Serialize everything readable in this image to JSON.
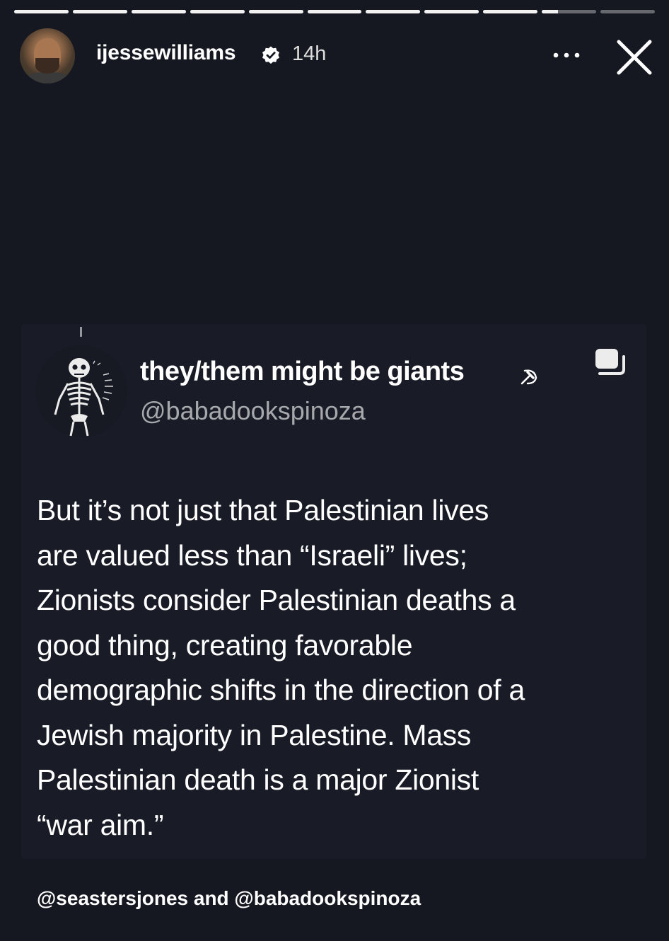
{
  "story": {
    "progress_segments": [
      1,
      1,
      1,
      1,
      1,
      1,
      1,
      1,
      1,
      0.3,
      0
    ],
    "username": "ijessewilliams",
    "verified": true,
    "time_ago": "14h",
    "more_icon": "more-horizontal-icon",
    "close_icon": "close-icon"
  },
  "tweet": {
    "display_name": "they/them might be giants",
    "name_emoji": "hammer-sickle-icon",
    "handle": "@babadookspinoza",
    "avatar_icon": "skeleton-icon",
    "copy_icon": "copy-icon",
    "text": "But it’s not just that Palestinian lives\nare valued less than “Israeli” lives;\nZionists consider Palestinian deaths a\ngood thing, creating favorable\ndemographic shifts in the direction of a\nJewish majority in Palestine. Mass\nPalestinian death is a major Zionist\n“war aim.”"
  },
  "mentions": "@seastersjones and @babadookspinoza",
  "colors": {
    "background": "#151820",
    "card": "#191c26",
    "text": "#ffffff",
    "muted": "#9ea1a8"
  }
}
